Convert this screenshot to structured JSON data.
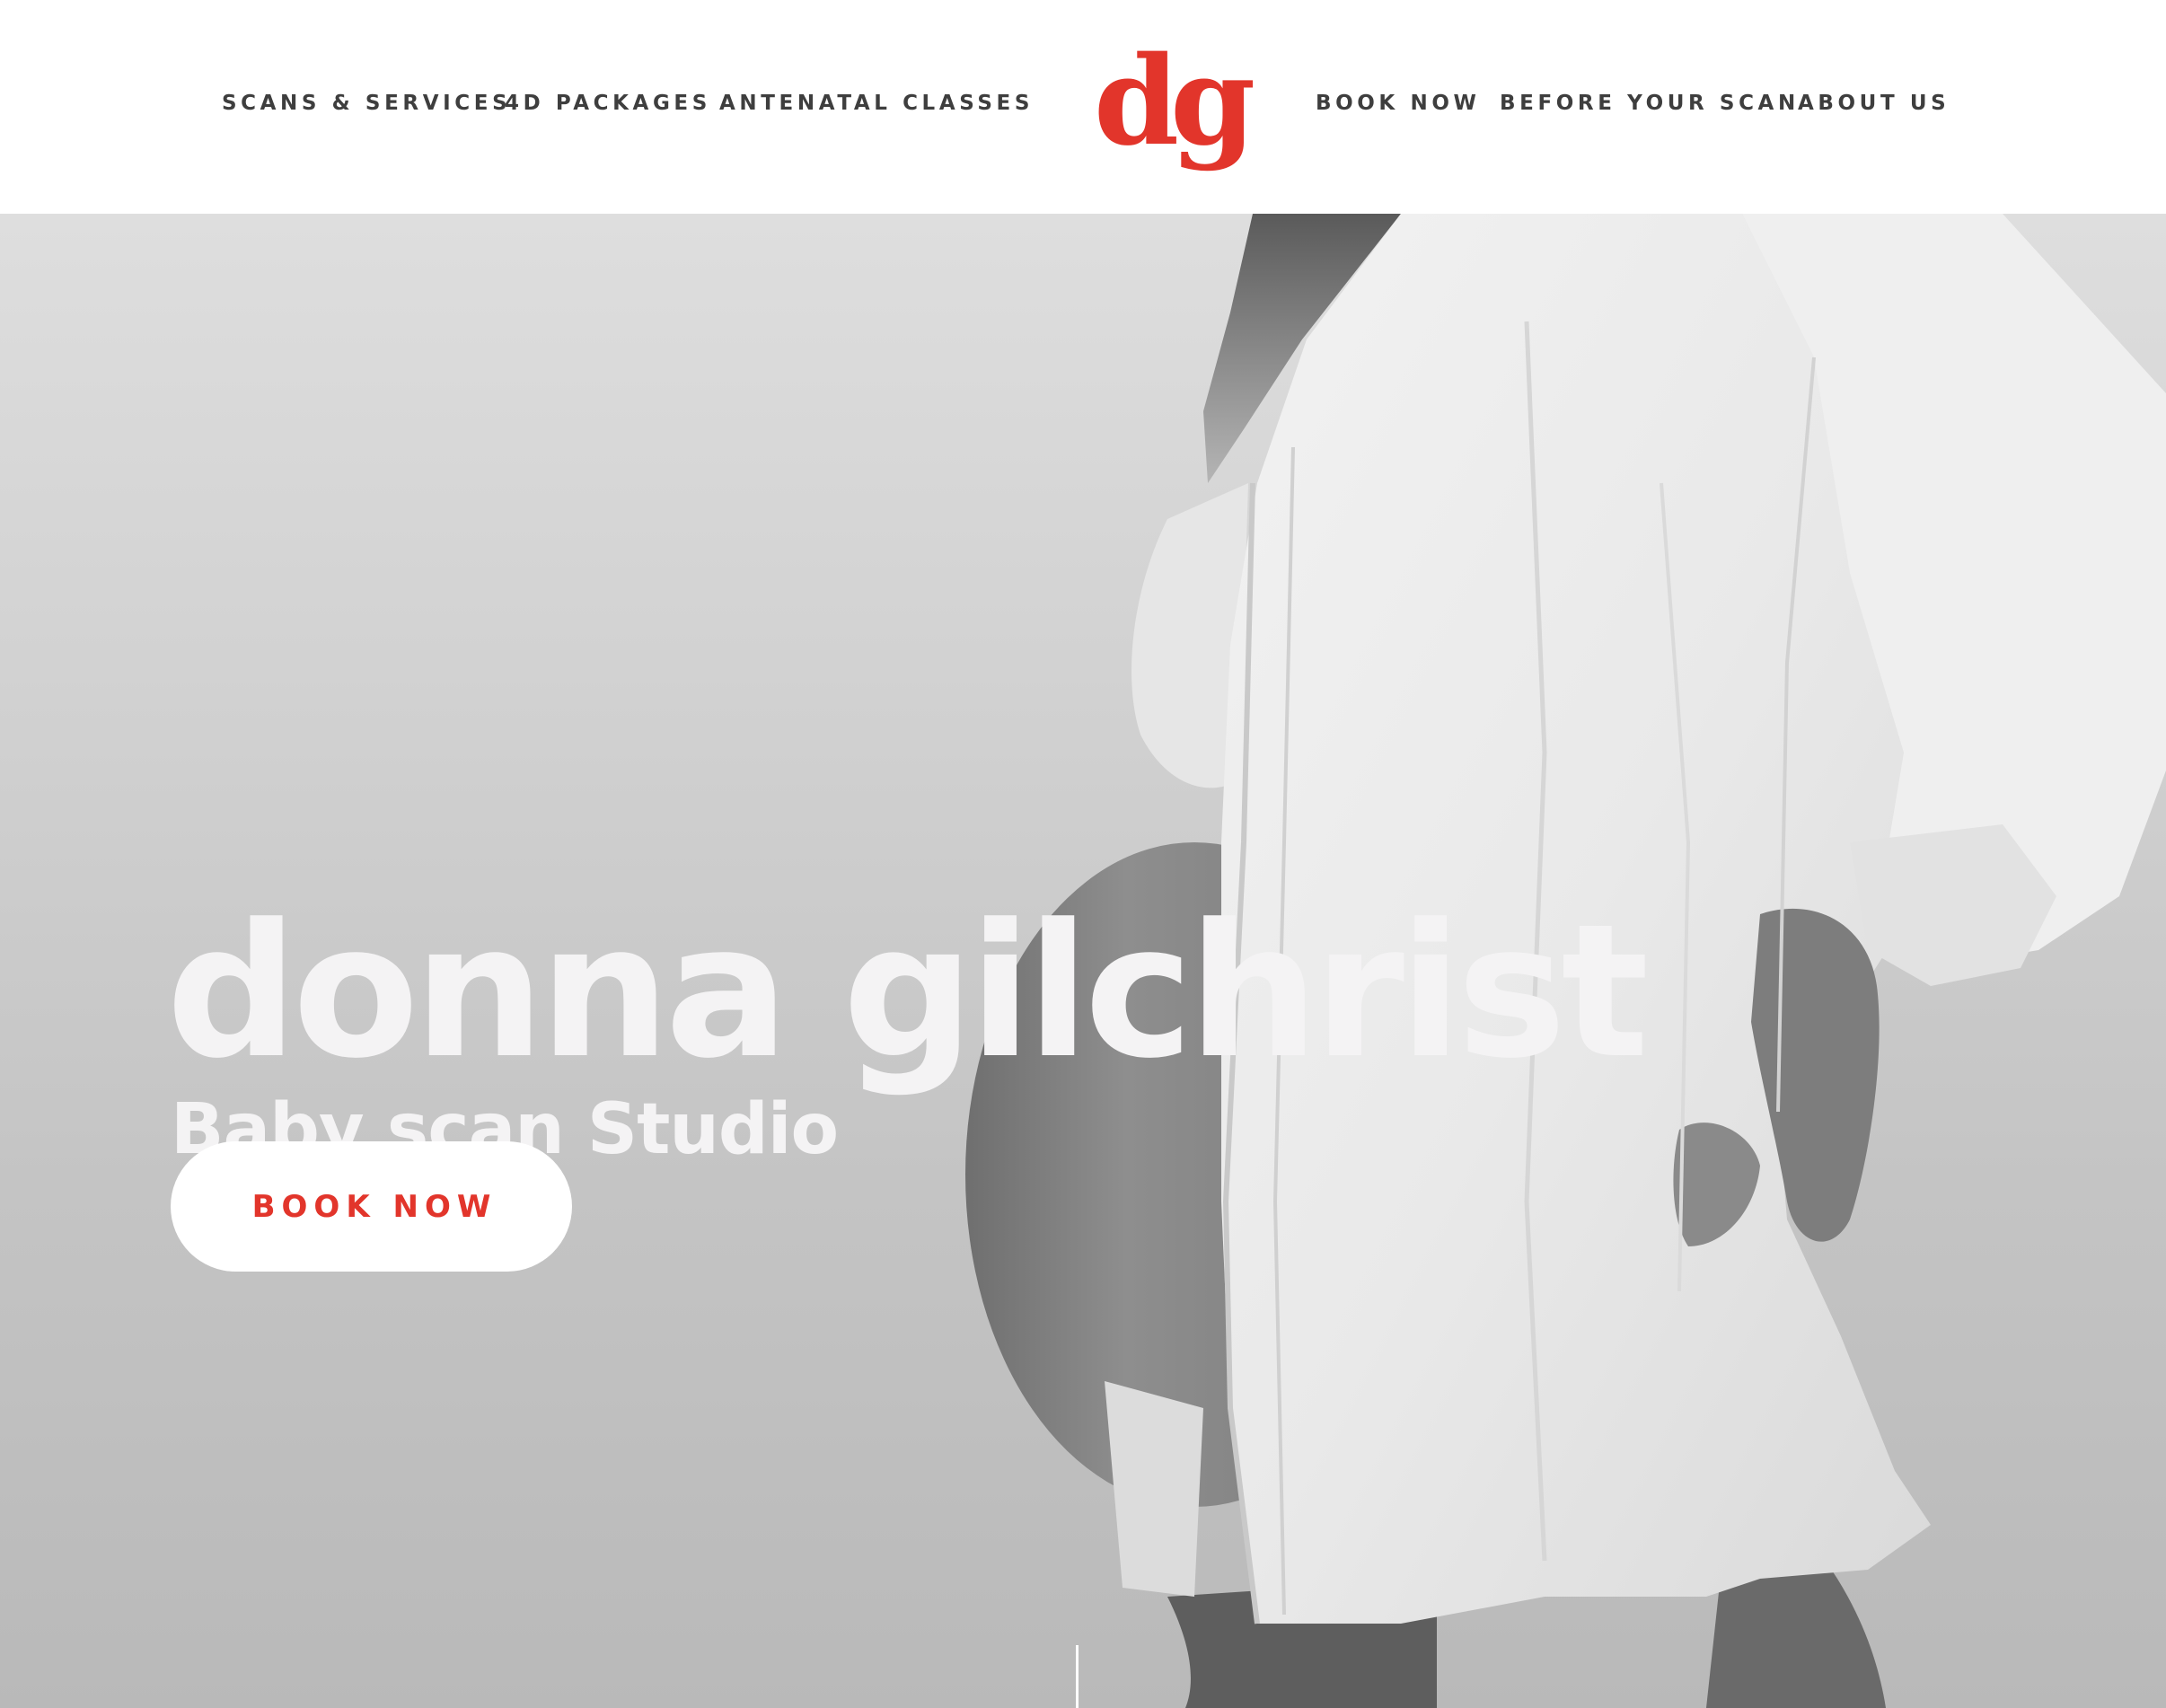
{
  "header": {
    "nav_left": [
      {
        "label": "SCANS & SERVICES"
      },
      {
        "label": "4D PACKAGES"
      },
      {
        "label": "ANTENATAL CLASSES"
      }
    ],
    "logo_text": "dg",
    "nav_right": [
      {
        "label": "BOOK NOW"
      },
      {
        "label": "BEFORE YOUR SCAN"
      },
      {
        "label": "ABOUT US"
      }
    ]
  },
  "hero": {
    "title": "donna gilchrist",
    "subtitle": "Baby scan Studio",
    "cta_label": "BOOK NOW",
    "image_subject": "pregnant woman in white shirt, side profile, black and white photo"
  },
  "colors": {
    "brand_red": "#e2352b",
    "nav_text": "#3e3e3e",
    "hero_text": "#f4f3f4",
    "header_bg": "#ffffff"
  }
}
